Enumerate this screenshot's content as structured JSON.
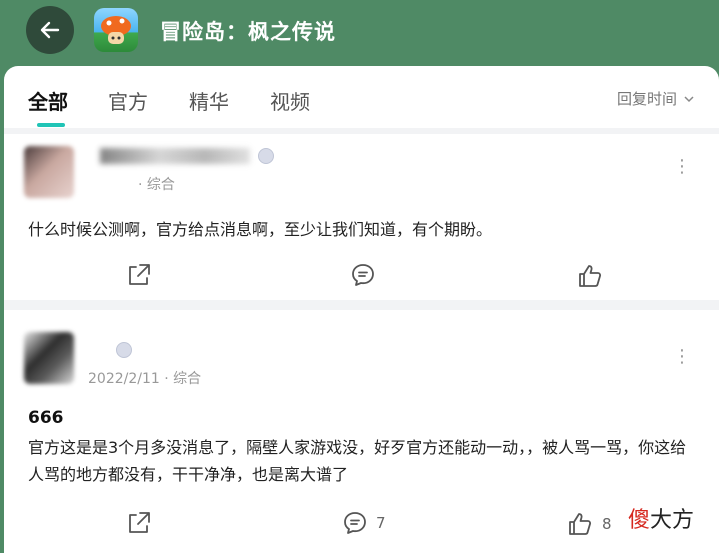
{
  "header": {
    "app_title": "冒险岛：枫之传说"
  },
  "tabs": [
    {
      "label": "全部",
      "active": true
    },
    {
      "label": "官方",
      "active": false
    },
    {
      "label": "精华",
      "active": false
    },
    {
      "label": "视频",
      "active": false
    }
  ],
  "sort": {
    "label": "回复时间"
  },
  "posts": [
    {
      "meta": "· 综合",
      "body": "什么时候公测啊，官方给点消息啊，至少让我们知道，有个期盼。",
      "comment_count": "",
      "like_count": ""
    },
    {
      "meta": "2022/2/11 · 综合",
      "title": "666",
      "body": "官方这是是3个月多没消息了，隔壁人家游戏没，好歹官方还能动一动，，被人骂一骂，你这给人骂的地方都没有，干干净净，也是离大谱了",
      "comment_count": "7",
      "like_count": "8"
    }
  ],
  "watermark": {
    "first": "傻",
    "rest": "大方"
  },
  "colors": {
    "header_bg": "#4f8a65",
    "accent": "#20c4b6"
  }
}
